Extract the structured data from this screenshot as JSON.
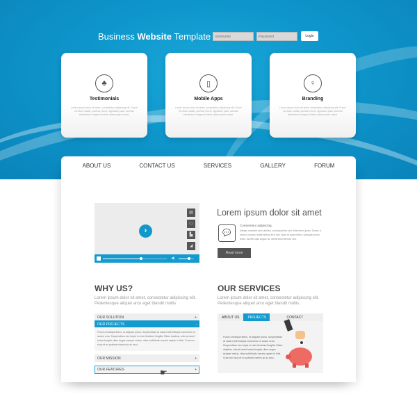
{
  "header": {
    "brand_prefix": "Business ",
    "brand_bold": "Website",
    "brand_suffix": " Template",
    "username_placeholder": "Username",
    "password_placeholder": "Password",
    "login_label": "Login"
  },
  "features": [
    {
      "title": "Testimonials",
      "icon": "group-icon",
      "glyph": "♣",
      "desc": "Lorem ipsum dolor sit amet, consectetur adipiscing elit. Fusce vel diam mattis, pulvinar nisi id, dignissim justo. Aenean elementum magna id tellus ullamcorper varius."
    },
    {
      "title": "Mobile Apps",
      "icon": "mobile-phone-icon",
      "glyph": "▯",
      "desc": "Lorem ipsum dolor sit amet, consectetur adipiscing elit. Fusce vel diam mattis, pulvinar nisi id, dignissim justo. Aenean elementum magna id tellus ullamcorper varius."
    },
    {
      "title": "Branding",
      "icon": "lightbulb-icon",
      "glyph": "♀",
      "desc": "Lorem ipsum dolor sit amet, consectetur adipiscing elit. Fusce vel diam mattis, pulvinar nisi id, dignissim justo. Aenean elementum magna id tellus ullamcorper varius."
    }
  ],
  "nav": [
    "ABOUT US",
    "CONTACT US",
    "SERVICES",
    "GALLERY",
    "FORUM"
  ],
  "video": {
    "progress": 0.6,
    "volume": 0.7,
    "side_icons": [
      "film-icon",
      "subtitles-icon",
      "stats-icon",
      "quality-icon"
    ]
  },
  "lorem": {
    "title": "Lorem ipsum dolor sit amet",
    "subtitle": "Consectetur adipiscing.",
    "body": "Integer molestie sem ultrices, consequat leo sed, bibendum quam. Donec a risus ut mauris mollis finibus et in nisl. Nam at quam tellus. Quisque ipsum tortor, laoreet quis augue ac, elementum tempor nisl.",
    "read_more": "Read more"
  },
  "why_us": {
    "title": "WHY US?",
    "intro": "Lorem ipsum dolor sit amet, consectetur adipiscing elit. Pellentesque aliquet arcu eget blandit mollis.",
    "items": [
      {
        "label": "OUR SOLUTION",
        "sign": "+"
      },
      {
        "label": "OUR PROJECTS",
        "sign": "-"
      },
      {
        "label": "OUR MISSION",
        "sign": "+"
      },
      {
        "label": "OUR FEATURES",
        "sign": "+"
      }
    ],
    "open_body": "Fusce a tristique libero, ut aliquam purus. Suspendisse at nulla id elit tristique commodo eu auctor urna. Suspendisse nec turpis in enim tincidunt fringilla. Etiam dapibus, odio sit amet luctus feugiat, diam augue semper metus, vitae sollicitudin mauris sapien in felis. Cras nec risus et ex pulvinar viverra ac ac arcu."
  },
  "services": {
    "title": "OUR SERVICES",
    "intro": "Lorem ipsum dolor sit amet, consectetur adipiscing elit. Pellentesque aliquet arcu eget blandit mollis.",
    "tabs": [
      "ABOUT US",
      "PROJECTS",
      "CONTACT"
    ],
    "active_tab": "PROJECTS",
    "body": "Fusce a tristique libero, ut aliquam purus. Suspendisse at nulla id elit tristique commodo eu auctor urna. Suspendisse nec turpis in enim tincidunt fringilla. Etiam dapibus, odio sit amet luctus feugiat, diam augue semper metus, vitae sollicitudin mauris sapien in felis. Cras nec risus et ex pulvinar viverra ac ac arcu."
  },
  "colors": {
    "accent": "#139bd0",
    "dark_button": "#555555"
  }
}
